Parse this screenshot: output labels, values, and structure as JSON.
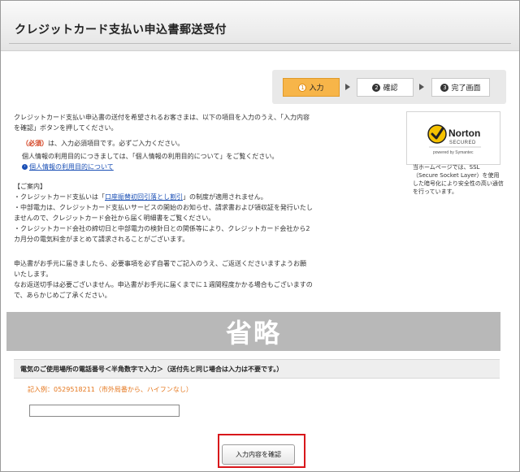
{
  "header": {
    "title": "クレジットカード支払い申込書郵送受付"
  },
  "steps": [
    {
      "num": "1",
      "label": "入力",
      "active": true
    },
    {
      "num": "2",
      "label": "確認",
      "active": false
    },
    {
      "num": "3",
      "label": "完了画面",
      "active": false
    }
  ],
  "intro": {
    "line1": "クレジットカード支払い申込書の送付を希望されるお客さまは、以下の項目を入力のうえ、「入力内容",
    "line2": "を確認」ボタンを押してください。",
    "required_tag": "（必須）",
    "required_text": "は、入力必須項目です。必ずご入力ください。",
    "privacy_text": "個人情報の利用目的につきましては、「個人情報の利用目的について」をご覧ください。",
    "privacy_link": "個人情報の利用目的について"
  },
  "notice": {
    "heading": "【ご案内】",
    "b1_pre": "・クレジットカード支払いは「",
    "b1_link": "口座振替初回引落とし割引",
    "b1_post": "」の制度が適用されません。",
    "b2_l1": "・中部電力は、クレジットカード支払いサービスの開始のお知らせ、請求書および領収証を発行いたし",
    "b2_l2": "ませんので、クレジットカード会社から届く明細書をご覧ください。",
    "b3_l1": "・クレジットカード会社の締切日と中部電力の検針日との関係等により、クレジットカード会社から2",
    "b3_l2": "カ月分の電気料金がまとめて請求されることがございます。"
  },
  "mail_note": {
    "l1": "申込書がお手元に届きましたら、必要事項を必ず自署でご記入のうえ、ご返送くださいますようお願",
    "l2": "いたします。",
    "l3": "なお返送切手は必要ございません。申込書がお手元に届くまでに１週間程度かかる場合もございますの",
    "l4": "で、あらかじめご了承ください。"
  },
  "norton": {
    "brand": "Norton",
    "secured": "SECURED",
    "powered": "powered by Symantec",
    "text": "当ホームページでは、SSL（Secure Socket Layer）を使用した暗号化により安全性の高い通信を行っています。"
  },
  "omit_label": "省略",
  "form": {
    "phone_label": "電気のご使用場所の電話番号＜半角数字で入力＞（送付先と同じ場合は入力は不要です。）",
    "example": "記入例：0529518211（市外局番から、ハイフンなし）",
    "phone_value": ""
  },
  "confirm_button": "入力内容を確認",
  "colors": {
    "required": "#d23a18",
    "link": "#1a4fb5",
    "example": "#e5761c",
    "highlight": "#d8171b",
    "active_step": "#f7b549"
  }
}
